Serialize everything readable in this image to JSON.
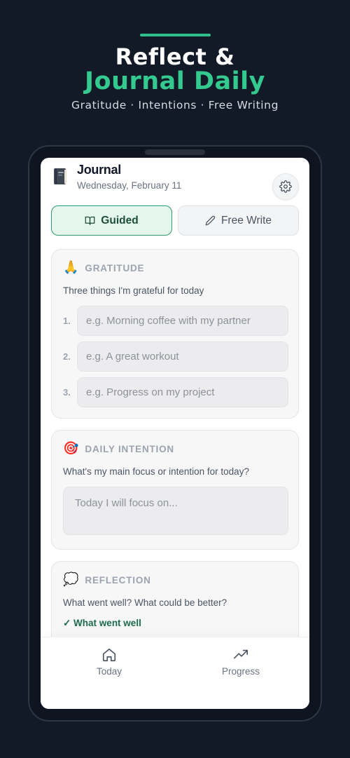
{
  "hero": {
    "title_line1": "Reflect &",
    "title_line2": "Journal Daily",
    "subtitle": "Gratitude · Intentions · Free Writing"
  },
  "header": {
    "title": "Journal",
    "date": "Wednesday, February 11"
  },
  "modes": {
    "guided": "Guided",
    "free_write": "Free Write",
    "active": "guided"
  },
  "gratitude": {
    "emoji": "🙏",
    "title": "GRATITUDE",
    "prompt": "Three things I'm grateful for today",
    "items": [
      {
        "num": "1.",
        "placeholder": "e.g. Morning coffee with my partner"
      },
      {
        "num": "2.",
        "placeholder": "e.g. A great workout"
      },
      {
        "num": "3.",
        "placeholder": "e.g. Progress on my project"
      }
    ]
  },
  "intention": {
    "emoji": "🎯",
    "title": "DAILY INTENTION",
    "prompt": "What's my main focus or intention for today?",
    "placeholder": "Today I will focus on..."
  },
  "reflection": {
    "emoji": "💭",
    "title": "REFLECTION",
    "prompt": "What went well? What could be better?",
    "went_well_label": "✓ What went well"
  },
  "tabbar": {
    "today": "Today",
    "progress": "Progress"
  },
  "colors": {
    "background": "#131a27",
    "accent": "#34c98f",
    "active_tab_bg": "#e5f6ef",
    "active_tab_border": "#2f9a6e"
  }
}
